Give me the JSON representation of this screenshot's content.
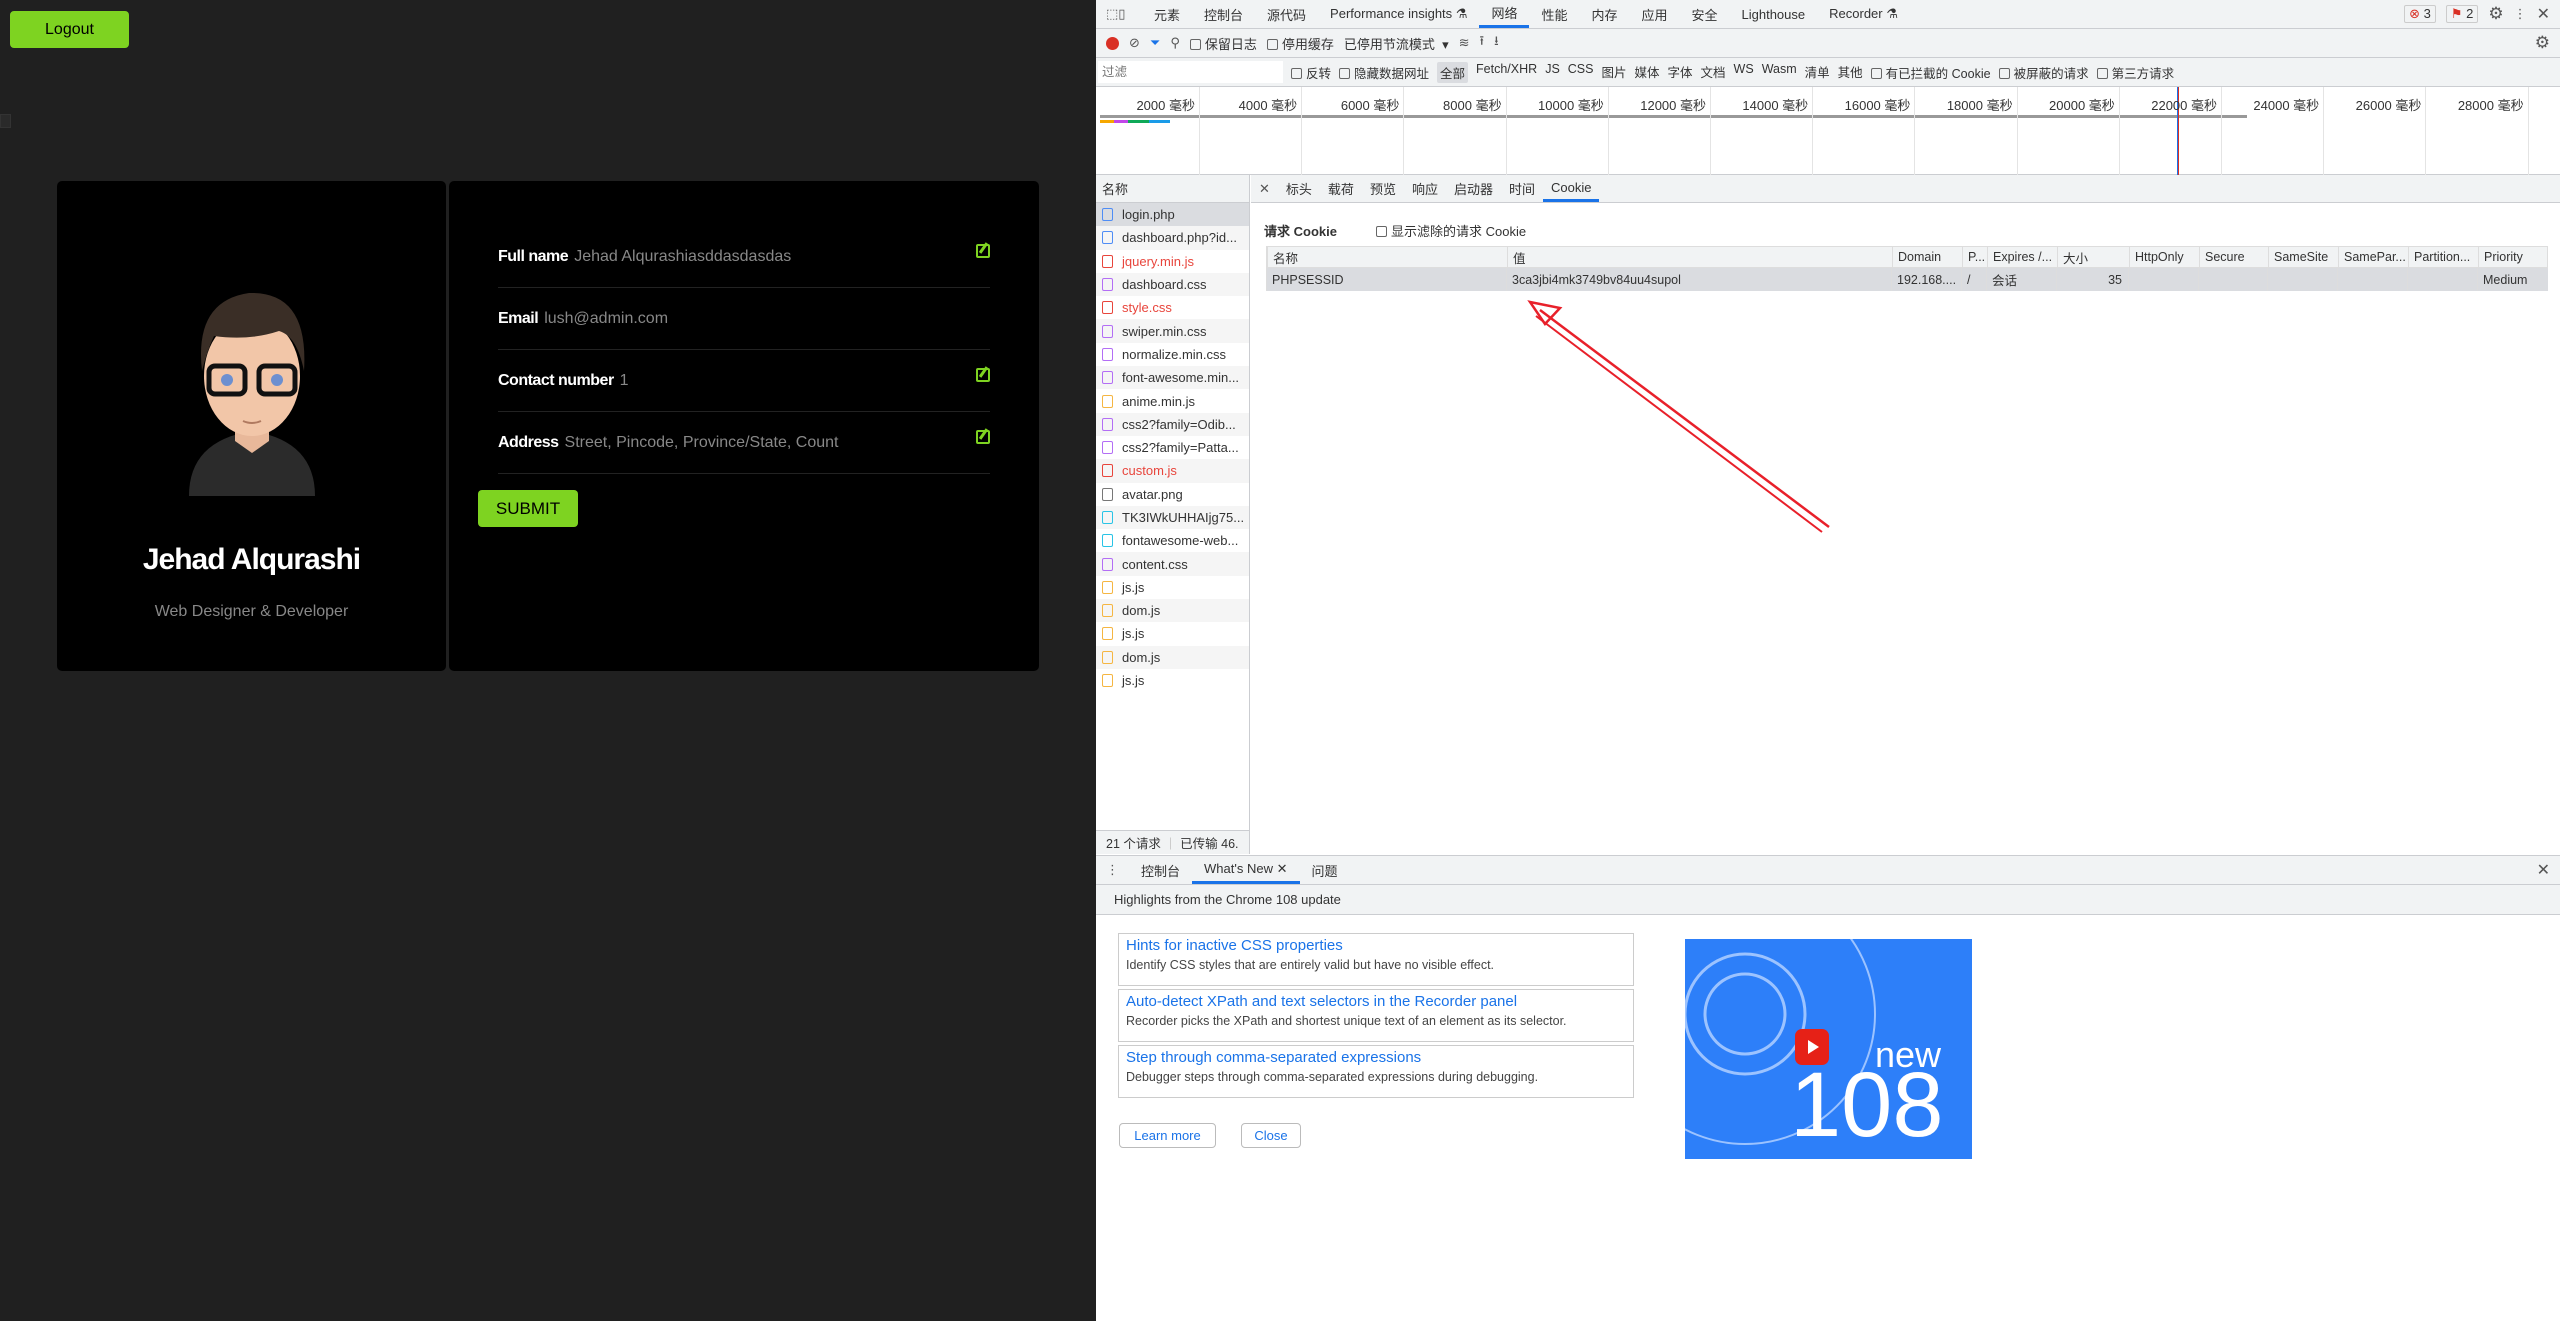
{
  "page": {
    "logout": "Logout",
    "name": "Jehad Alqurashi",
    "role": "Web Designer & Developer",
    "submit": "SUBMIT",
    "fields": [
      {
        "label": "Full name",
        "value": "Jehad Alqurashiasddasdasdas",
        "editable": true
      },
      {
        "label": "Email",
        "value": "lush@admin.com",
        "editable": false
      },
      {
        "label": "Contact number",
        "value": "1",
        "editable": true
      },
      {
        "label": "Address",
        "value": "Street, Pincode, Province/State, Count",
        "editable": true
      }
    ],
    "accent": "#7ed321"
  },
  "devtools": {
    "tabs": [
      "元素",
      "控制台",
      "源代码",
      "Performance insights ⚗",
      "网络",
      "性能",
      "内存",
      "应用",
      "安全",
      "Lighthouse",
      "Recorder ⚗"
    ],
    "active_tab": "网络",
    "errors": "3",
    "issues": "2",
    "toolbar": {
      "preserve_log": "保留日志",
      "disable_cache": "停用缓存",
      "throttle": "已停用节流模式"
    },
    "filter": {
      "placeholder": "过滤",
      "invert": "反转",
      "hide_data_urls": "隐藏数据网址",
      "types": [
        "全部",
        "Fetch/XHR",
        "JS",
        "CSS",
        "图片",
        "媒体",
        "字体",
        "文档",
        "WS",
        "Wasm",
        "清单",
        "其他"
      ],
      "blocked_cookies": "有已拦截的 Cookie",
      "blocked_requests": "被屏蔽的请求",
      "third_party": "第三方请求"
    },
    "timeline_ticks": [
      "2000 毫秒",
      "4000 毫秒",
      "6000 毫秒",
      "8000 毫秒",
      "10000 毫秒",
      "12000 毫秒",
      "14000 毫秒",
      "16000 毫秒",
      "18000 毫秒",
      "20000 毫秒",
      "22000 毫秒",
      "24000 毫秒",
      "26000 毫秒",
      "28000 毫秒"
    ],
    "name_header": "名称",
    "requests": [
      {
        "n": "login.php",
        "t": "doc"
      },
      {
        "n": "dashboard.php?id...",
        "t": "doc"
      },
      {
        "n": "jquery.min.js",
        "t": "err"
      },
      {
        "n": "dashboard.css",
        "t": "css"
      },
      {
        "n": "style.css",
        "t": "errcss"
      },
      {
        "n": "swiper.min.css",
        "t": "css"
      },
      {
        "n": "normalize.min.css",
        "t": "css"
      },
      {
        "n": "font-awesome.min...",
        "t": "css"
      },
      {
        "n": "anime.min.js",
        "t": "js"
      },
      {
        "n": "css2?family=Odib...",
        "t": "css"
      },
      {
        "n": "css2?family=Patta...",
        "t": "css"
      },
      {
        "n": "custom.js",
        "t": "err"
      },
      {
        "n": "avatar.png",
        "t": "img"
      },
      {
        "n": "TK3IWkUHHAIjg75...",
        "t": "font"
      },
      {
        "n": "fontawesome-web...",
        "t": "font"
      },
      {
        "n": "content.css",
        "t": "css"
      },
      {
        "n": "js.js",
        "t": "js"
      },
      {
        "n": "dom.js",
        "t": "js"
      },
      {
        "n": "js.js",
        "t": "js"
      },
      {
        "n": "dom.js",
        "t": "js"
      },
      {
        "n": "js.js",
        "t": "js"
      }
    ],
    "status": {
      "count": "21 个请求",
      "transferred": "已传输 46."
    },
    "detail_tabs": [
      "标头",
      "载荷",
      "预览",
      "响应",
      "启动器",
      "时间",
      "Cookie"
    ],
    "cookie": {
      "title": "请求 Cookie",
      "show_filtered": "显示滤除的请求 Cookie",
      "columns": [
        "名称",
        "值",
        "Domain",
        "P...",
        "Expires /...",
        "大小",
        "HttpOnly",
        "Secure",
        "SameSite",
        "SamePar...",
        "Partition...",
        "Priority"
      ],
      "rows": [
        [
          "PHPSESSID",
          "3ca3jbi4mk3749bv84uu4supol",
          "192.168....",
          "/",
          "会话",
          "35",
          "",
          "",
          "",
          "",
          "",
          "Medium"
        ]
      ]
    },
    "drawer": {
      "tabs": [
        "控制台",
        "What's New",
        "问题"
      ],
      "highlights": "Highlights from the Chrome 108 update",
      "items": [
        {
          "title": "Hints for inactive CSS properties",
          "desc": "Identify CSS styles that are entirely valid but have no visible effect."
        },
        {
          "title": "Auto-detect XPath and text selectors in the Recorder panel",
          "desc": "Recorder picks the XPath and shortest unique text of an element as its selector."
        },
        {
          "title": "Step through comma-separated expressions",
          "desc": "Debugger steps through comma-separated expressions during debugging."
        }
      ],
      "learn_more": "Learn more",
      "close": "Close",
      "video_new": "new",
      "video_num": "108"
    }
  }
}
